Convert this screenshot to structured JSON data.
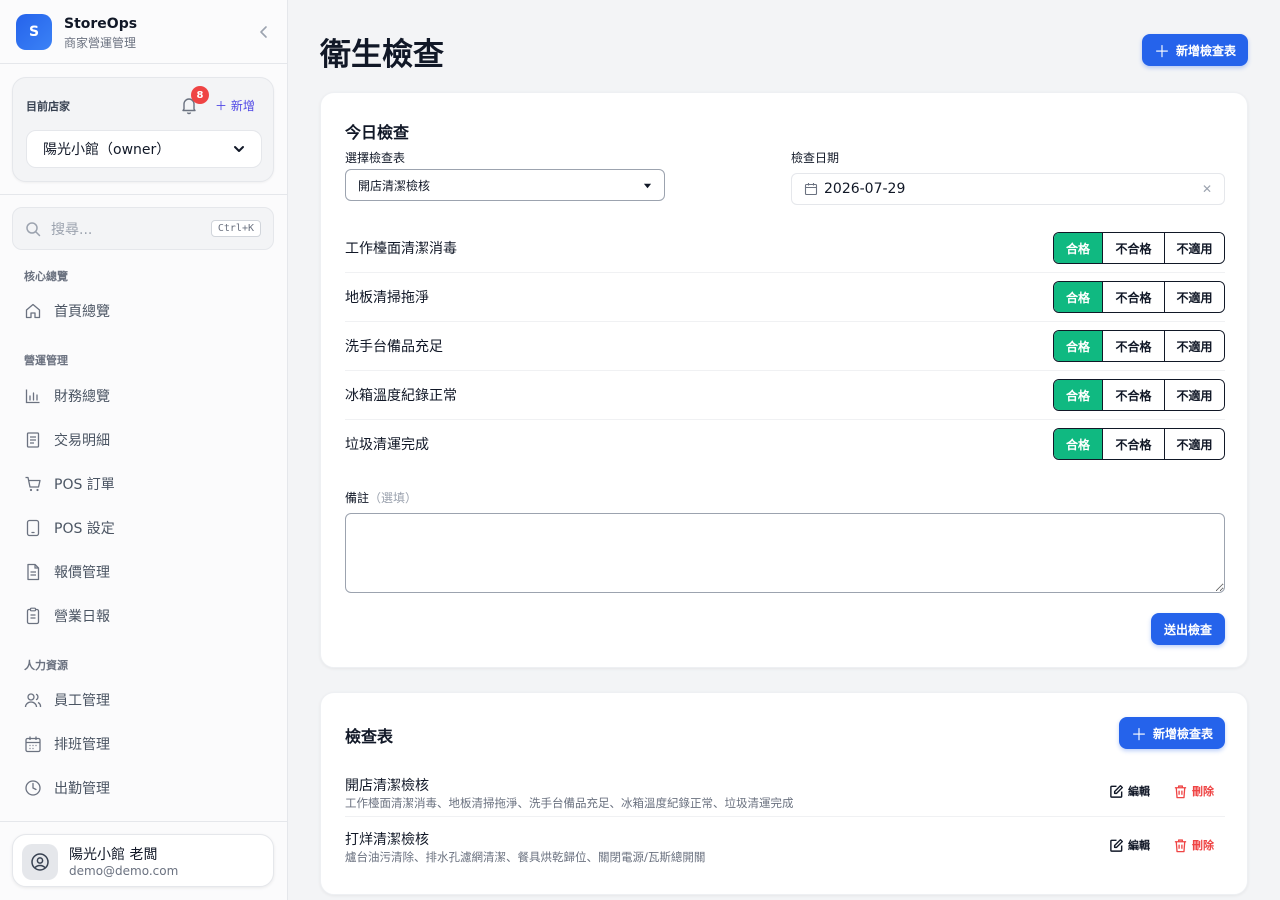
{
  "brand": {
    "logo_letter": "S",
    "name": "StoreOps",
    "subtitle": "商家營運管理"
  },
  "store": {
    "label": "目前店家",
    "notification_count": "8",
    "add_label": "新增",
    "selected": "陽光小館（owner）"
  },
  "search": {
    "placeholder": "搜尋...",
    "shortcut": "Ctrl+K"
  },
  "nav": {
    "sections": [
      {
        "title": "核心總覽",
        "items": [
          {
            "label": "首頁總覽",
            "icon": "home-icon"
          }
        ]
      },
      {
        "title": "營運管理",
        "items": [
          {
            "label": "財務總覽",
            "icon": "bar-chart-icon"
          },
          {
            "label": "交易明細",
            "icon": "receipt-icon"
          },
          {
            "label": "POS 訂單",
            "icon": "cart-icon"
          },
          {
            "label": "POS 設定",
            "icon": "tablet-icon"
          },
          {
            "label": "報價管理",
            "icon": "document-icon"
          },
          {
            "label": "營業日報",
            "icon": "clipboard-icon"
          }
        ]
      },
      {
        "title": "人力資源",
        "items": [
          {
            "label": "員工管理",
            "icon": "users-icon"
          },
          {
            "label": "排班管理",
            "icon": "calendar-icon"
          },
          {
            "label": "出勤管理",
            "icon": "clock-icon"
          }
        ]
      }
    ]
  },
  "user": {
    "name": "陽光小館 老闆",
    "email": "demo@demo.com"
  },
  "page": {
    "title": "衛生檢查",
    "add_button": "新增檢查表"
  },
  "today": {
    "title": "今日檢查",
    "sheet_label": "選擇檢查表",
    "sheet_value": "開店清潔檢核",
    "date_label": "檢查日期",
    "date_value": "2026-07-29",
    "items": [
      {
        "label": "工作檯面清潔消毒",
        "status": "合格"
      },
      {
        "label": "地板清掃拖淨",
        "status": "合格"
      },
      {
        "label": "洗手台備品充足",
        "status": "合格"
      },
      {
        "label": "冰箱溫度紀錄正常",
        "status": "合格"
      },
      {
        "label": "垃圾清運完成",
        "status": "合格"
      }
    ],
    "options": {
      "pass": "合格",
      "fail": "不合格",
      "na": "不適用"
    },
    "note_label": "備註",
    "note_optional": "（選填）",
    "note_value": "",
    "submit": "送出檢查"
  },
  "sheets": {
    "title": "檢查表",
    "add_button": "新增檢查表",
    "edit_label": "編輯",
    "delete_label": "刪除",
    "rows": [
      {
        "name": "開店清潔檢核",
        "items": "工作檯面清潔消毒、地板清掃拖淨、洗手台備品充足、冰箱溫度紀錄正常、垃圾清運完成"
      },
      {
        "name": "打烊清潔檢核",
        "items": "爐台油污清除、排水孔濾網清潔、餐具烘乾歸位、關閉電源/瓦斯總開關"
      }
    ]
  },
  "colors": {
    "accent": "#2563eb",
    "pass": "#10b981",
    "danger": "#ef4444",
    "badge": "#ef4444"
  }
}
